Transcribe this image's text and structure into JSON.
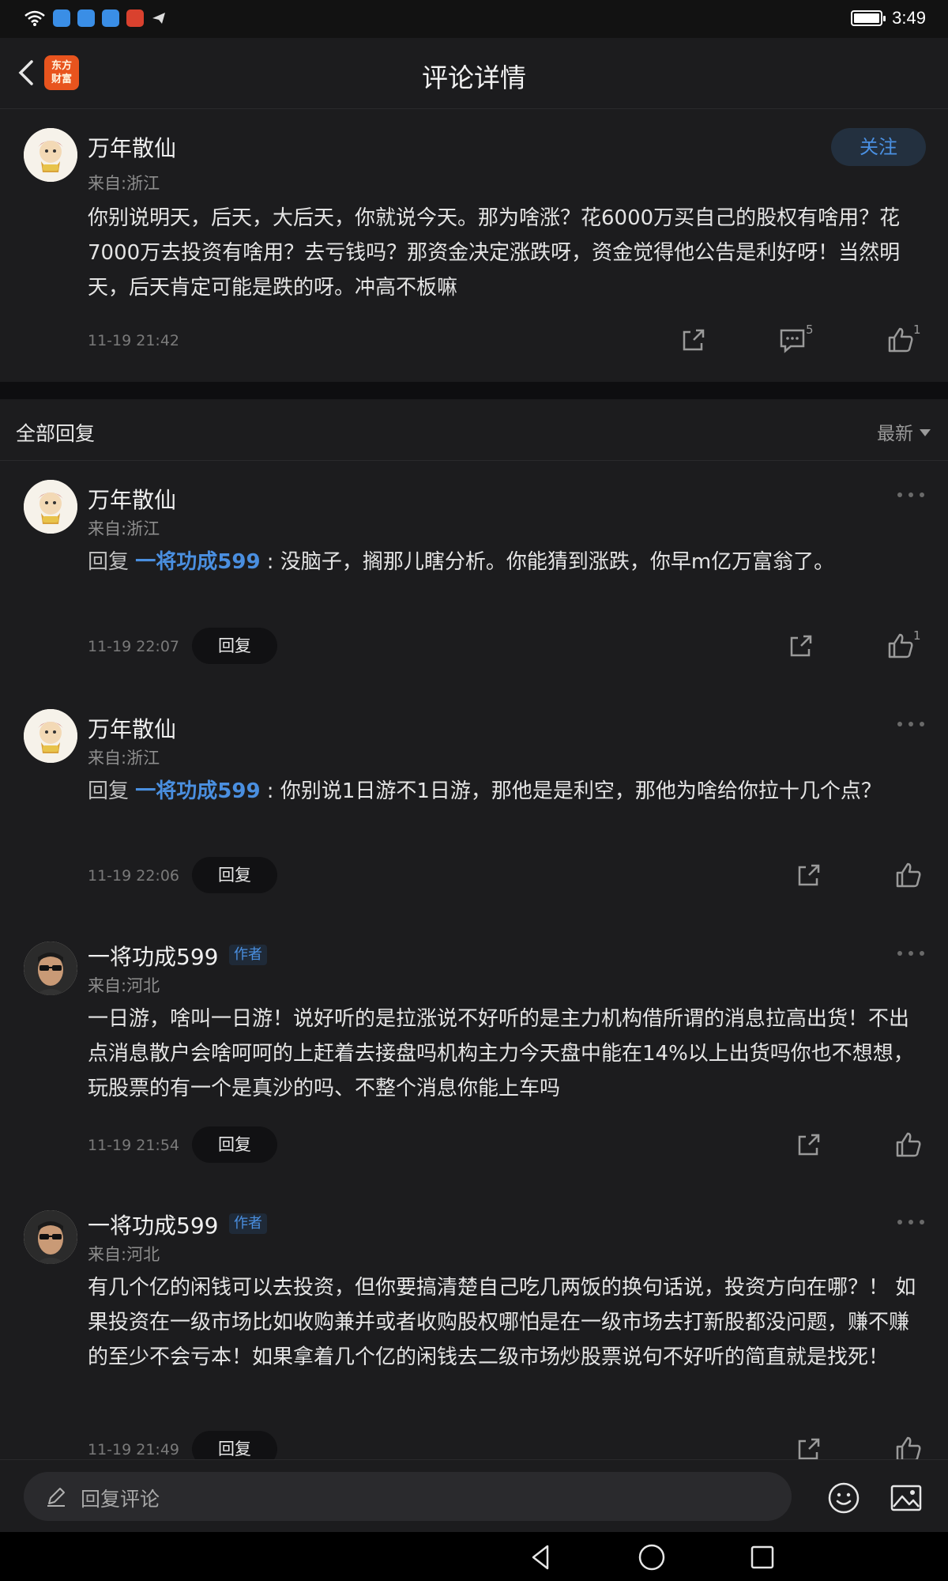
{
  "status_bar": {
    "time": "3:49"
  },
  "header": {
    "title": "评论详情",
    "logo_text": "东方财富"
  },
  "main_post": {
    "author": "万年散仙",
    "from": "来自:浙江",
    "follow_label": "关注",
    "content": "你别说明天，后天，大后天，你就说今天。那为啥涨？花6000万买自己的股权有啥用？花7000万去投资有啥用？去亏钱吗？那资金决定涨跌呀，资金觉得他公告是利好呀！当然明天，后天肯定可能是跌的呀。冲高不板嘛",
    "time": "11-19 21:42",
    "comment_count": "5",
    "like_count": "1"
  },
  "replies_header": {
    "title": "全部回复",
    "sort": "最新"
  },
  "replies": [
    {
      "author": "万年散仙",
      "from": "来自:浙江",
      "prefix": "回复 ",
      "mention": "一将功成599",
      "text": " : 没脑子，搁那儿瞎分析。你能猜到涨跌，你早m亿万富翁了。",
      "time": "11-19 22:07",
      "reply_label": "回复",
      "like_count": "1"
    },
    {
      "author": "万年散仙",
      "from": "来自:浙江",
      "prefix": "回复 ",
      "mention": "一将功成599",
      "text": " : 你别说1日游不1日游，那他是是利空，那他为啥给你拉十几个点？",
      "time": "11-19 22:06",
      "reply_label": "回复",
      "like_count": ""
    },
    {
      "author": "一将功成599",
      "author_tag": "作者",
      "from": "来自:河北",
      "text": "一日游，啥叫一日游！说好听的是拉涨说不好听的是主力机构借所谓的消息拉高出货！不出点消息散户会啥呵呵的上赶着去接盘吗机构主力今天盘中能在14%以上出货吗你也不想想，玩股票的有一个是真沙的吗、不整个消息你能上车吗",
      "time": "11-19 21:54",
      "reply_label": "回复"
    },
    {
      "author": "一将功成599",
      "author_tag": "作者",
      "from": "来自:河北",
      "text": "有几个亿的闲钱可以去投资，但你要搞清楚自己吃几两饭的换句话说，投资方向在哪？！ 如果投资在一级市场比如收购兼并或者收购股权哪怕是在一级市场去打新股都没问题，赚不赚的至少不会亏本！如果拿着几个亿的闲钱去二级市场炒股票说句不好听的简直就是找死！",
      "time": "11-19 21:49",
      "reply_label": "回复"
    }
  ],
  "input_bar": {
    "placeholder": "回复评论"
  },
  "icons": {
    "back": "chevron-left-icon",
    "share": "share-icon",
    "comment": "comment-icon",
    "like": "thumbs-up-icon",
    "more": "more-dots-icon",
    "pencil": "pencil-icon",
    "emoji": "emoji-icon",
    "image": "image-icon"
  }
}
